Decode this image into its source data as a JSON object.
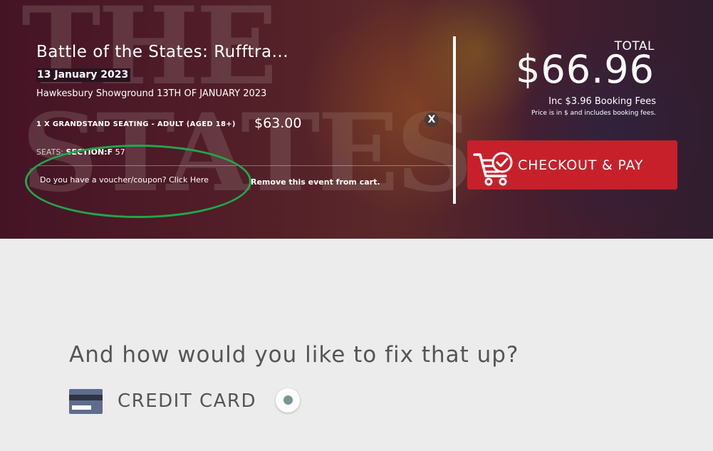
{
  "event": {
    "title": "Battle of the States: Rufftra...",
    "date": "13 January 2023",
    "venue": "Hawkesbury Showground 13TH OF JANUARY 2023",
    "ticket_line": "1 X GRANDSTAND SEATING - ADULT (AGED 18+)",
    "ticket_price": "$63.00",
    "remove_x": "X",
    "seats_label": "SEATS:",
    "seats_section": "SECTION:F",
    "seats_number": "57",
    "voucher_link": "Do you have a voucher/coupon? Click Here",
    "remove_link": "Remove this event from cart."
  },
  "hero_bg_text": "THE STATES",
  "summary": {
    "total_label": "TOTAL",
    "total_amount": "$66.96",
    "fees_line": "Inc $3.96 Booking Fees",
    "fees_note": "Price is in $ and includes booking fees."
  },
  "checkout": {
    "label": "CHECKOUT & PAY",
    "icon": "cart-check-icon",
    "color": "#c7202a"
  },
  "payment": {
    "heading": "And how would you like to fix that up?",
    "methods": [
      {
        "label": "CREDIT CARD",
        "icon": "credit-card-icon",
        "selected": true
      }
    ]
  },
  "annotation": {
    "color": "#1fa84a"
  }
}
